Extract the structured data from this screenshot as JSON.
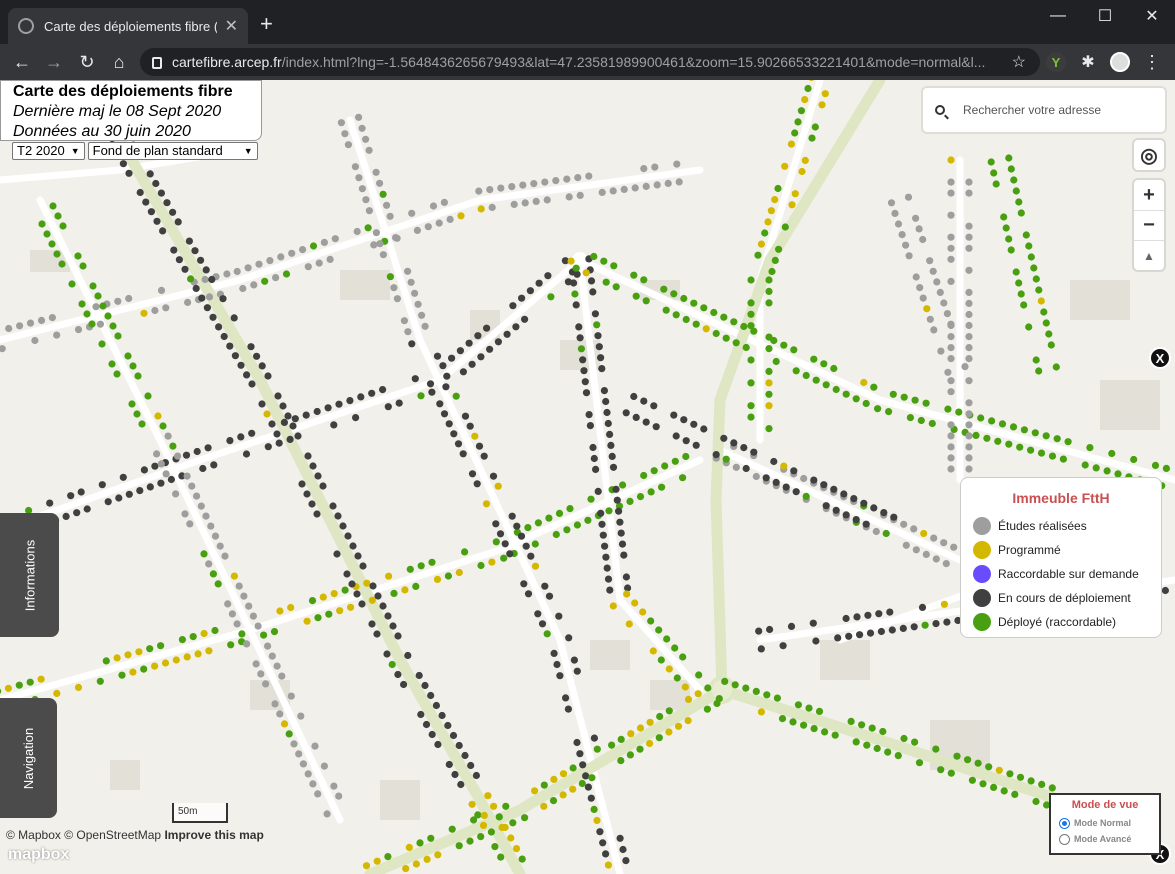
{
  "browser": {
    "tab_title": "Carte des déploiements fibre (Ftt",
    "tab_close": "✕",
    "new_tab": "+",
    "window_controls": {
      "minimize": "—",
      "maximize": "☐",
      "close": "✕"
    },
    "nav": {
      "back": "←",
      "forward": "→",
      "reload": "↻",
      "home": "⌂"
    },
    "url_host": "cartefibre.arcep.fr",
    "url_path": "/index.html?lng=-1.5648436265679493&lat=47.23581989900461&zoom=15.90266533221401&mode=normal&l...",
    "star": "☆",
    "extensions": {
      "ext1": "Y",
      "puzzle": "✱",
      "menu": "⋮"
    }
  },
  "map": {
    "title": "Carte des déploiements fibre",
    "updated": "Dernière maj le 08 Sept 2020",
    "data_date": "Données au 30 juin 2020",
    "period_select": "T2 2020",
    "basemap_select": "Fond de plan standard",
    "search_placeholder": "Rechercher votre adresse",
    "controls": {
      "locate": "◎",
      "zoom_in": "+",
      "zoom_out": "−",
      "compass": "▲"
    },
    "close_label": "X",
    "side_tabs": {
      "informations": "Informations",
      "navigation": "Navigation"
    },
    "legend": {
      "title": "Immeuble FttH",
      "items": [
        {
          "label": "Études réalisées",
          "color": "#9e9e9e"
        },
        {
          "label": "Programmé",
          "color": "#d4b800"
        },
        {
          "label": "Raccordable sur demande",
          "color": "#6a4cff"
        },
        {
          "label": "En cours de déploiement",
          "color": "#404040"
        },
        {
          "label": "Déployé (raccordable)",
          "color": "#48a010"
        }
      ]
    },
    "view_mode": {
      "title": "Mode de vue",
      "normal": "Mode Normal",
      "advanced": "Mode Avancé",
      "selected": "normal"
    },
    "scale_label": "50m",
    "attribution": {
      "mapbox": "© Mapbox",
      "osm": "© OpenStreetMap",
      "improve": "Improve this map"
    },
    "mapbox_logo": "mapbox"
  }
}
